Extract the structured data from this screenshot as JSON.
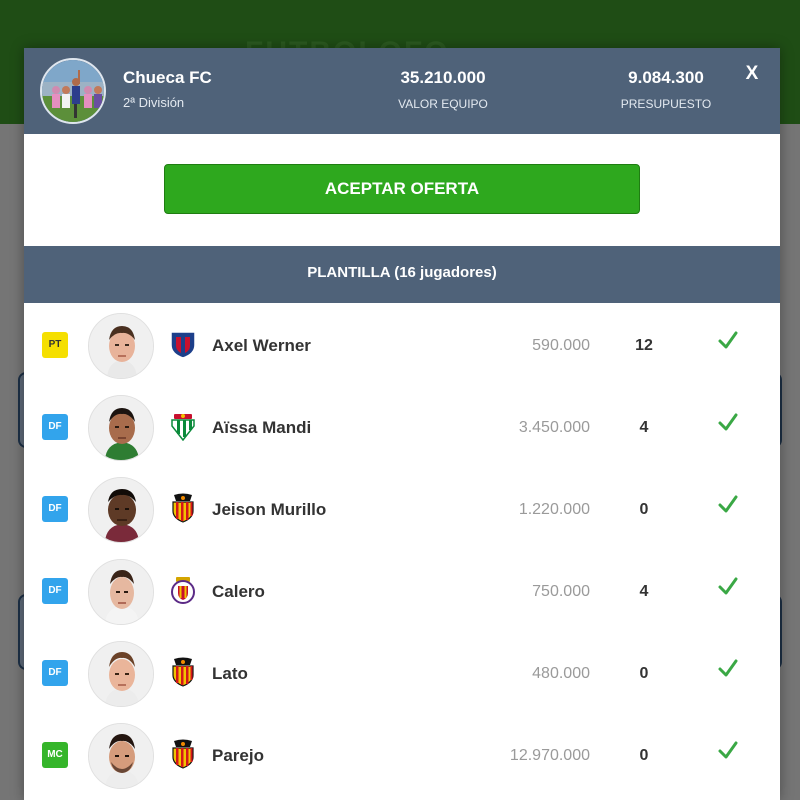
{
  "background": {
    "app_logo_text": "FUTBOLOFO"
  },
  "team": {
    "name": "Chueca FC",
    "division": "2ª División",
    "team_value": "35.210.000",
    "team_value_label": "VALOR EQUIPO",
    "budget": "9.084.300",
    "budget_label": "PRESUPUESTO"
  },
  "close_label": "X",
  "accept_offer_label": "ACEPTAR OFERTA",
  "squad_header": "PLANTILLA (16 jugadores)",
  "colors": {
    "header_bg": "#4f6279",
    "accept_green": "#2ea81e",
    "check_green": "#3aa845",
    "pos_PT": "#f5df00",
    "pos_DF": "#32a4ec",
    "pos_MC": "#35b52a"
  },
  "players": [
    {
      "position": "PT",
      "name": "Axel Werner",
      "club_icon": "huesca-crest-icon",
      "price": "590.000",
      "points": "12"
    },
    {
      "position": "DF",
      "name": "Aïssa Mandi",
      "club_icon": "betis-crest-icon",
      "price": "3.450.000",
      "points": "4"
    },
    {
      "position": "DF",
      "name": "Jeison Murillo",
      "club_icon": "valencia-crest-icon",
      "price": "1.220.000",
      "points": "0"
    },
    {
      "position": "DF",
      "name": "Calero",
      "club_icon": "valladolid-crest-icon",
      "price": "750.000",
      "points": "4"
    },
    {
      "position": "DF",
      "name": "Lato",
      "club_icon": "valencia-crest-icon",
      "price": "480.000",
      "points": "0"
    },
    {
      "position": "MC",
      "name": "Parejo",
      "club_icon": "valencia-crest-icon",
      "price": "12.970.000",
      "points": "0"
    }
  ]
}
